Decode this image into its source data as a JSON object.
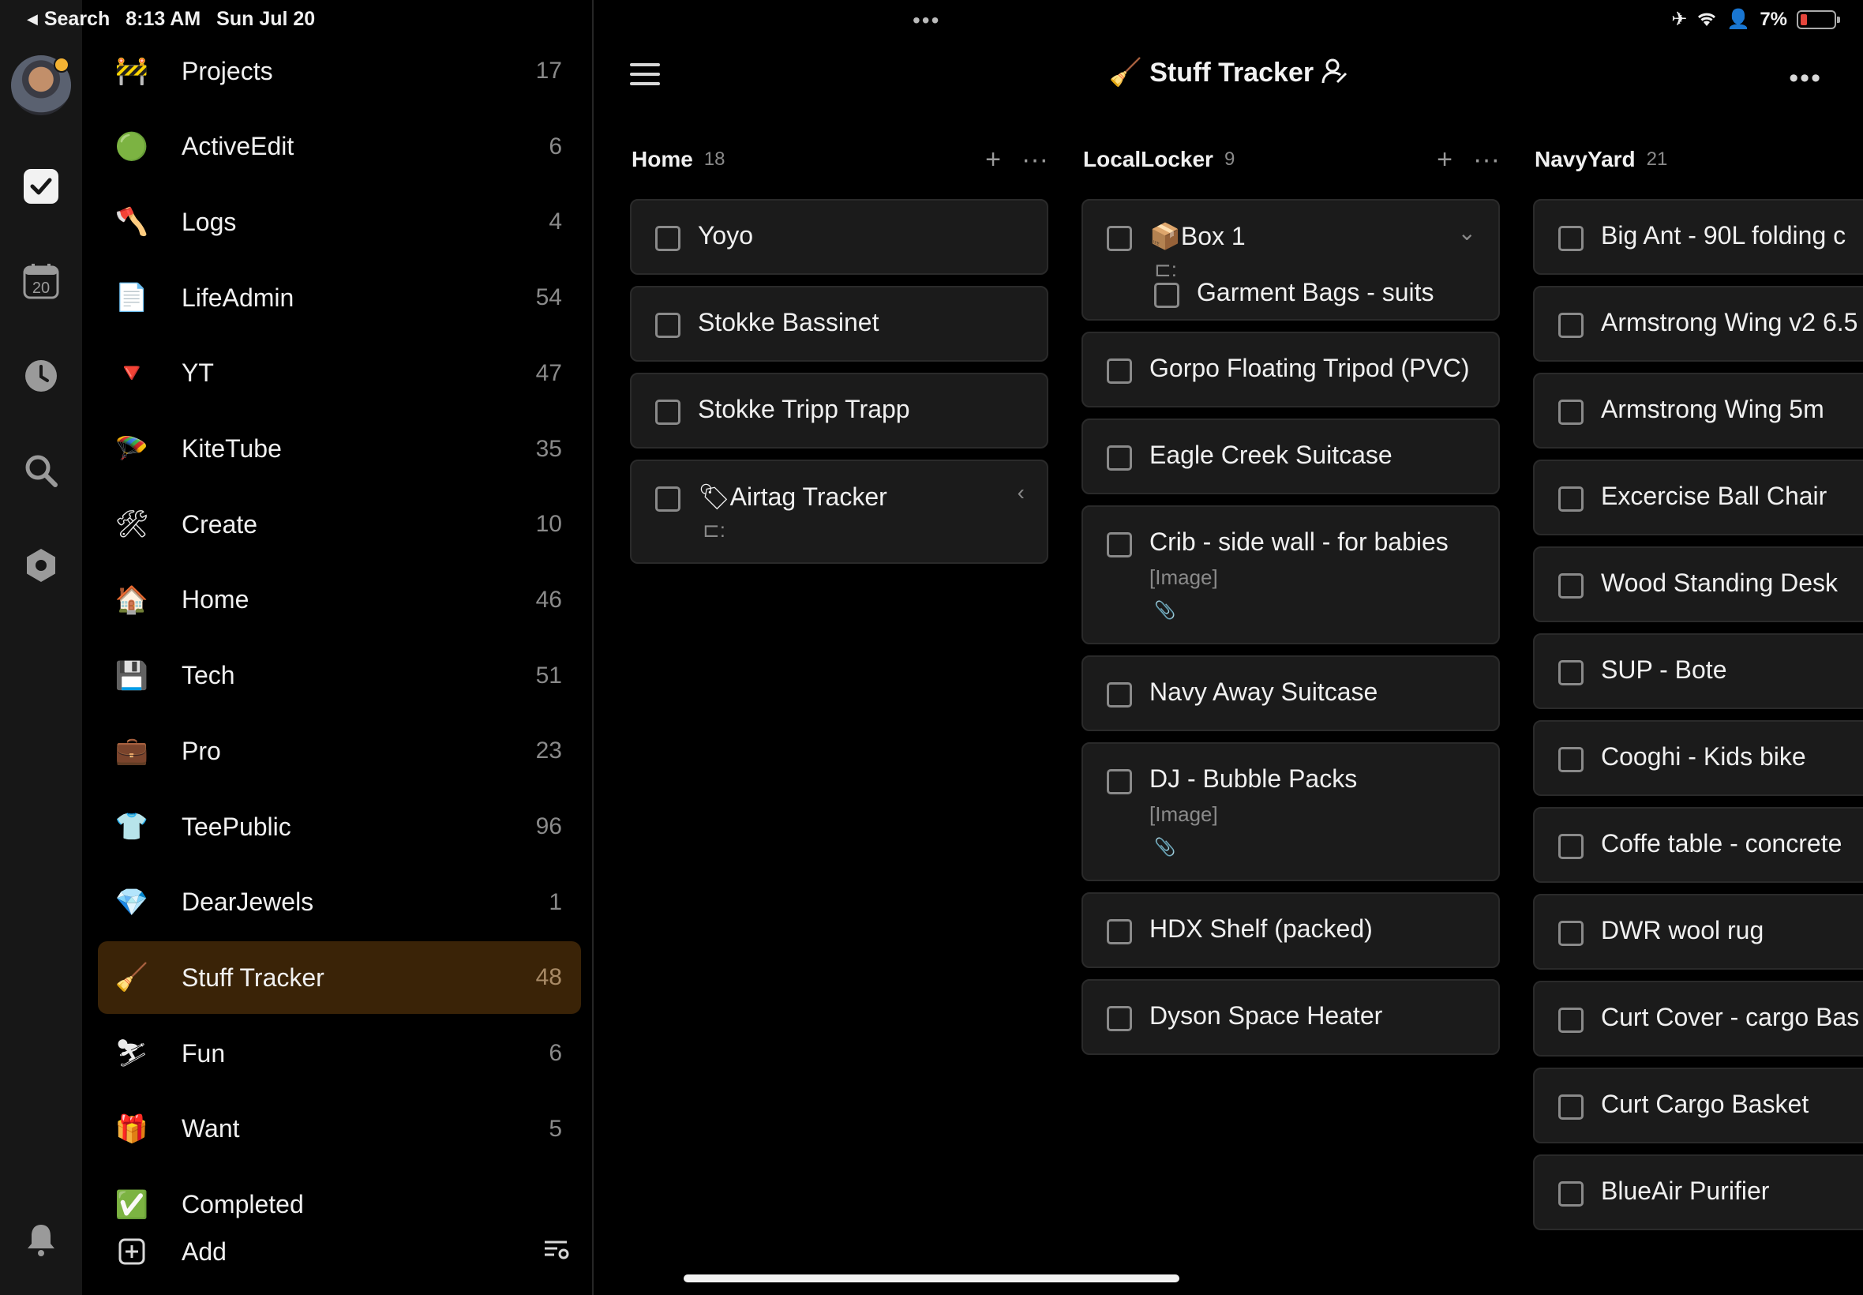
{
  "status_bar": {
    "back_label": "Search",
    "time": "8:13 AM",
    "date": "Sun Jul 20",
    "battery": "7%",
    "battery_level": 0.07
  },
  "rail": {
    "calendar_day": "20"
  },
  "sidebar": {
    "projects": [
      {
        "icon": "roadblock-icon",
        "emoji": "🚧",
        "name": "Projects",
        "count": "17"
      },
      {
        "icon": "green-circle-icon",
        "emoji": "🟢",
        "name": "ActiveEdit",
        "count": "6"
      },
      {
        "icon": "axe-icon",
        "emoji": "🪓",
        "name": "Logs",
        "count": "4"
      },
      {
        "icon": "document-icon",
        "emoji": "📄",
        "name": "LifeAdmin",
        "count": "54"
      },
      {
        "icon": "red-triangle-icon",
        "emoji": "🔻",
        "name": "YT",
        "count": "47"
      },
      {
        "icon": "parachute-icon",
        "emoji": "🪂",
        "name": "KiteTube",
        "count": "35"
      },
      {
        "icon": "tools-icon",
        "emoji": "🛠",
        "name": "Create",
        "count": "10"
      },
      {
        "icon": "house-icon",
        "emoji": "🏠",
        "name": "Home",
        "count": "46"
      },
      {
        "icon": "floppy-disk-icon",
        "emoji": "💾",
        "name": "Tech",
        "count": "51"
      },
      {
        "icon": "briefcase-icon",
        "emoji": "💼",
        "name": "Pro",
        "count": "23"
      },
      {
        "icon": "tshirt-icon",
        "emoji": "👕",
        "name": "TeePublic",
        "count": "96"
      },
      {
        "icon": "gem-icon",
        "emoji": "💎",
        "name": "DearJewels",
        "count": "1"
      },
      {
        "icon": "tools-broom-icon",
        "emoji": "🧹",
        "name": "Stuff Tracker",
        "count": "48"
      },
      {
        "icon": "skier-icon",
        "emoji": "⛷",
        "name": "Fun",
        "count": "6"
      },
      {
        "icon": "gift-icon",
        "emoji": "🎁",
        "name": "Want",
        "count": "5"
      },
      {
        "icon": "checkbox-icon",
        "emoji": "✅",
        "name": "Completed",
        "count": ""
      }
    ],
    "add_label": "Add"
  },
  "main": {
    "title": "Stuff Tracker",
    "title_emoji": "🧹",
    "columns": [
      {
        "title": "Home",
        "count": "18",
        "cards": [
          {
            "title": "Yoyo"
          },
          {
            "title": "Stokke Bassinet"
          },
          {
            "title": "Stokke Tripp Trapp"
          },
          {
            "title": "Airtag Tracker",
            "emoji": "🏷",
            "subtask_marker": "⊏:",
            "chevron": "‹"
          }
        ]
      },
      {
        "title": "LocalLocker",
        "count": "9",
        "cards": [
          {
            "title": "Box 1",
            "emoji": "📦",
            "subtask_marker": "⊏:",
            "chevron": "⌄",
            "subtask": "Garment Bags - suits"
          },
          {
            "title": "Gorpo Floating Tripod (PVC)"
          },
          {
            "title": "Eagle Creek Suitcase"
          },
          {
            "title": "Crib - side wall - for babies",
            "description": "[Image]",
            "attachment": "📎"
          },
          {
            "title": "Navy Away Suitcase"
          },
          {
            "title": "DJ - Bubble Packs",
            "description": "[Image]",
            "attachment": "📎"
          },
          {
            "title": "HDX Shelf (packed)"
          },
          {
            "title": "Dyson Space Heater"
          }
        ]
      },
      {
        "title": "NavyYard",
        "count": "21",
        "cards": [
          {
            "title": "Big Ant - 90L folding c"
          },
          {
            "title": "Armstrong Wing v2 6.5"
          },
          {
            "title": "Armstrong Wing 5m"
          },
          {
            "title": "Excercise Ball Chair"
          },
          {
            "title": "Wood Standing Desk"
          },
          {
            "title": "SUP - Bote"
          },
          {
            "title": "Cooghi - Kids bike"
          },
          {
            "title": "Coffe table - concrete"
          },
          {
            "title": "DWR wool rug"
          },
          {
            "title": "Curt Cover - cargo Bas"
          },
          {
            "title": "Curt Cargo Basket"
          },
          {
            "title": "BlueAir Purifier"
          }
        ]
      }
    ]
  },
  "colors": {
    "accent": "#3a2307",
    "card_bg": "#1b1b1b",
    "rail_bg": "#171717",
    "battery_red": "#e5453b"
  }
}
